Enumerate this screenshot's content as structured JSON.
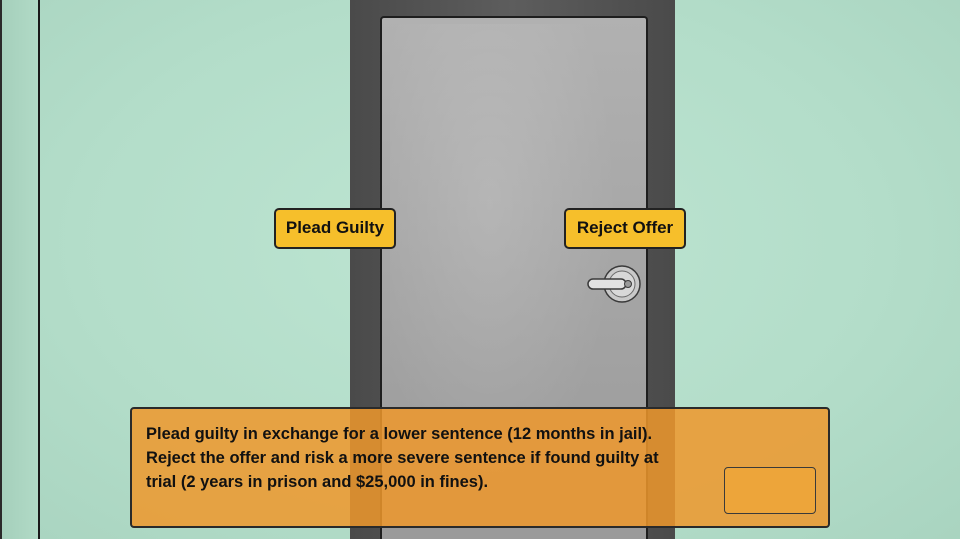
{
  "choices": {
    "plead_guilty_label": "Plead Guilty",
    "reject_offer_label": "Reject Offer"
  },
  "dialog": {
    "lines": [
      "Plead guilty in exchange for a lower sentence (12 months in jail).",
      "Reject the offer and risk a more severe sentence if found guilty at",
      "trial (2 years in prison and $25,000 in fines)."
    ]
  },
  "colors": {
    "wall": "#b6dfcc",
    "door": "#a8a8a8",
    "door_frame": "#555555",
    "button": "#f6bf2b",
    "dialog": "#ee982c"
  },
  "icons": {
    "handle": "door-handle-icon"
  }
}
